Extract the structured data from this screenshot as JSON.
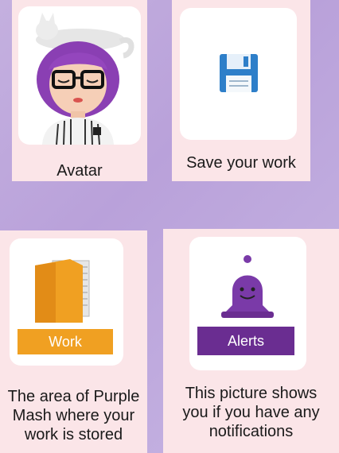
{
  "cards": {
    "avatar": {
      "caption": "Avatar",
      "icon": "avatar-icon"
    },
    "save": {
      "caption": "Save your work",
      "icon": "floppy-disk-icon"
    },
    "work": {
      "label": "Work",
      "caption_lines": [
        "The area of Purple",
        "Mash where your",
        "work is stored"
      ],
      "icon": "folder-icon",
      "label_color": "#f0a022"
    },
    "alerts": {
      "label": "Alerts",
      "caption_lines": [
        "This picture shows",
        "you if you have any",
        "notifications"
      ],
      "icon": "bell-icon",
      "label_color": "#6a2d91"
    }
  }
}
